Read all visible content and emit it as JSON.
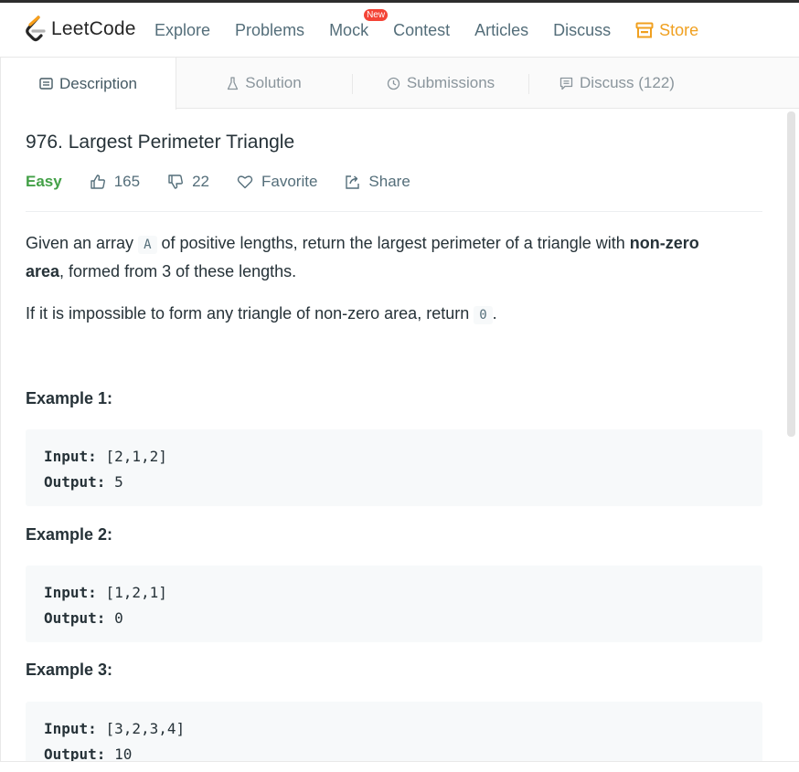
{
  "nav": {
    "logo_text": "LeetCode",
    "items": [
      "Explore",
      "Problems",
      "Mock",
      "Contest",
      "Articles",
      "Discuss"
    ],
    "new_badge": "New",
    "store": "Store",
    "store_color": "#f0a020"
  },
  "tabs": [
    {
      "label": "Description",
      "icon": "description-icon"
    },
    {
      "label": "Solution",
      "icon": "flask-icon"
    },
    {
      "label": "Submissions",
      "icon": "clock-icon"
    },
    {
      "label": "Discuss (122)",
      "icon": "comment-icon"
    }
  ],
  "problem": {
    "title": "976. Largest Perimeter Triangle",
    "difficulty": "Easy",
    "difficulty_color": "#43a047",
    "likes": "165",
    "dislikes": "22",
    "favorite_label": "Favorite",
    "share_label": "Share"
  },
  "description": {
    "p1_a": "Given an array ",
    "p1_code": "A",
    "p1_b": " of positive lengths, return the largest perimeter of a triangle with ",
    "p1_bold1": "non-zero",
    "p1_bold2": "area",
    "p1_c": ", formed from 3 of these lengths.",
    "p2_a": "If it is impossible to form any triangle of non-zero area, return ",
    "p2_code": "0",
    "p2_b": "."
  },
  "examples": [
    {
      "title": "Example 1:",
      "input_label": "Input:",
      "input": "[2,1,2]",
      "output_label": "Output:",
      "output": "5"
    },
    {
      "title": "Example 2:",
      "input_label": "Input:",
      "input": "[1,2,1]",
      "output_label": "Output:",
      "output": "0"
    },
    {
      "title": "Example 3:",
      "input_label": "Input:",
      "input": "[3,2,3,4]",
      "output_label": "Output:",
      "output": "10"
    }
  ]
}
